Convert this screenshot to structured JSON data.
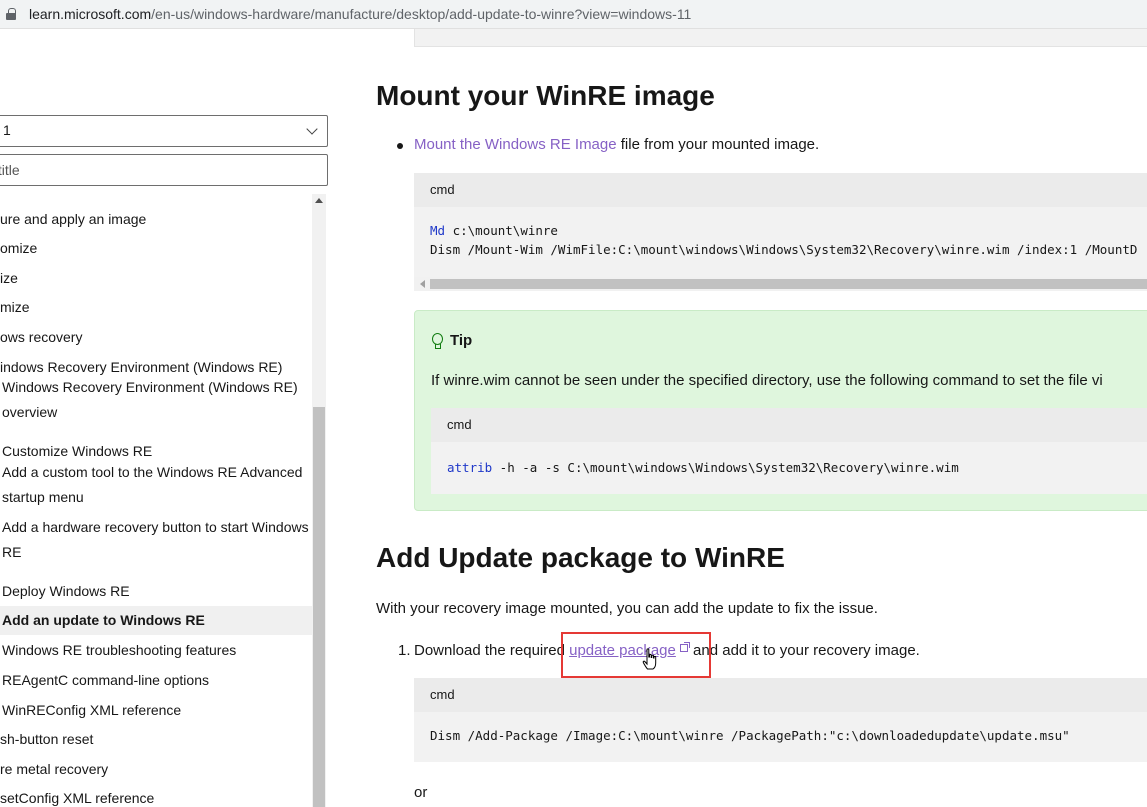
{
  "browser": {
    "url_host": "learn.microsoft.com",
    "url_path": "/en-us/windows-hardware/manufacture/desktop/add-update-to-winre?view=windows-11"
  },
  "sidebar": {
    "version_value": "1",
    "filter_placeholder": "y title",
    "items": [
      {
        "label": "ure and apply an image"
      },
      {
        "label": "omize"
      },
      {
        "label": "ize"
      },
      {
        "label": "mize"
      },
      {
        "label": "ows recovery"
      },
      {
        "label": "indows Recovery Environment (Windows RE)"
      },
      {
        "label": "Windows Recovery Environment (Windows RE) overview"
      },
      {
        "label": "Customize Windows RE"
      },
      {
        "label": "Add a custom tool to the Windows RE Advanced startup menu"
      },
      {
        "label": "Add a hardware recovery button to start Windows RE"
      },
      {
        "label": "Deploy Windows RE"
      },
      {
        "label": "Add an update to Windows RE"
      },
      {
        "label": "Windows RE troubleshooting features"
      },
      {
        "label": "REAgentC command-line options"
      },
      {
        "label": "WinREConfig XML reference"
      },
      {
        "label": "sh-button reset"
      },
      {
        "label": "re metal recovery"
      },
      {
        "label": "setConfig XML reference"
      }
    ]
  },
  "main": {
    "section1": {
      "heading": "Mount your WinRE image",
      "bullet_link": "Mount the Windows RE Image",
      "bullet_text": " file from your mounted image.",
      "code_label": "cmd",
      "code_kw": "Md",
      "code_line1_rest": " c:\\mount\\winre",
      "code_line2": "Dism /Mount-Wim /WimFile:C:\\mount\\windows\\Windows\\System32\\Recovery\\winre.wim /index:1 /MountD"
    },
    "tip": {
      "title": "Tip",
      "text": "If winre.wim cannot be seen under the specified directory, use the following command to set the file vi",
      "code_label": "cmd",
      "code_kw": "attrib",
      "code_rest": " -h -a -s C:\\mount\\windows\\Windows\\System32\\Recovery\\winre.wim"
    },
    "section2": {
      "heading": "Add Update package to WinRE",
      "intro": "With your recovery image mounted, you can add the update to fix the issue.",
      "step_number": "1.",
      "step_before": "Download the required ",
      "step_link": "update package",
      "step_after": " and add it to your recovery image.",
      "code_label": "cmd",
      "code_line": "Dism /Add-Package /Image:C:\\mount\\winre /PackagePath:\"c:\\downloadedupdate\\update.msu\"",
      "or_text": "or"
    }
  },
  "colors": {
    "link": "#8661c5",
    "tip_bg": "#dff6dd",
    "highlight_border": "#e53935",
    "keyword": "#1f38c9"
  }
}
